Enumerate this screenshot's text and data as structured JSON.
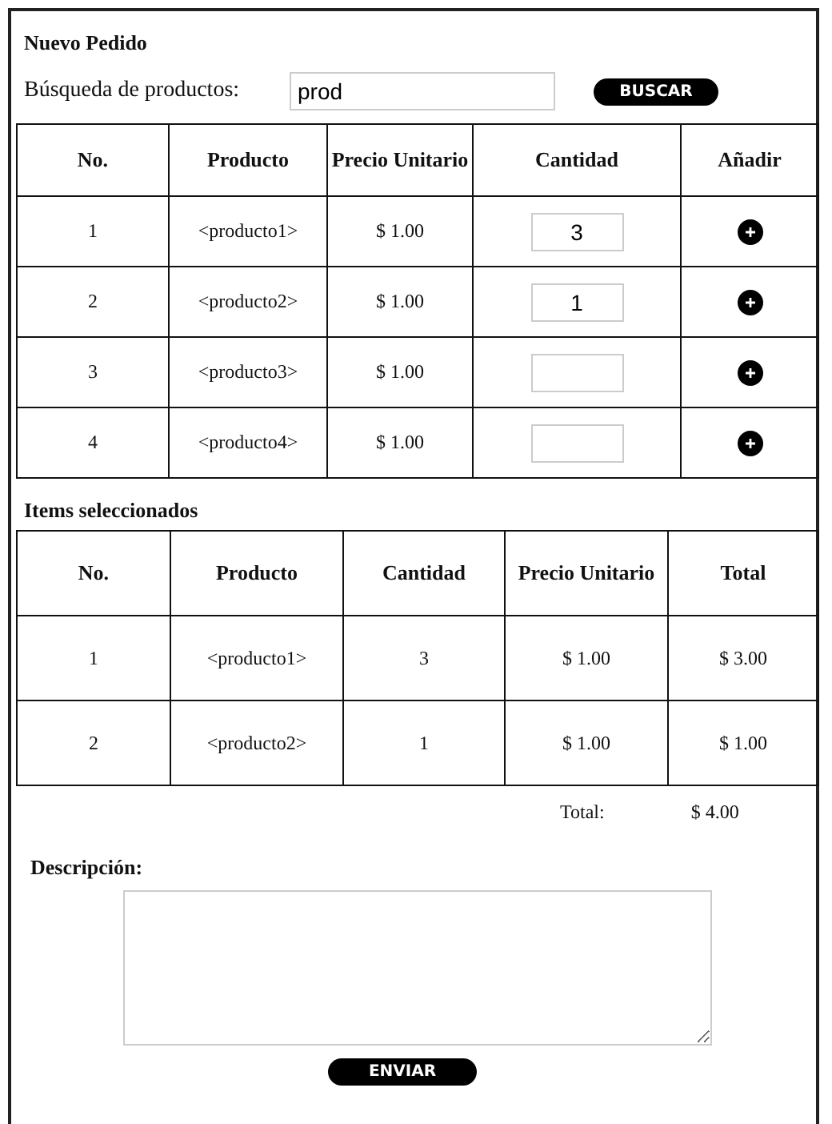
{
  "title": "Nuevo Pedido",
  "search": {
    "label": "Búsqueda de productos:",
    "value": "prod",
    "button": "BUSCAR"
  },
  "products": {
    "columns": [
      "No.",
      "Producto",
      "Precio Unitario",
      "Cantidad",
      "Añadir"
    ],
    "rows": [
      {
        "no": "1",
        "product": "<producto1>",
        "price": "$ 1.00",
        "quantity": "3"
      },
      {
        "no": "2",
        "product": "<producto2>",
        "price": "$ 1.00",
        "quantity": "1"
      },
      {
        "no": "3",
        "product": "<producto3>",
        "price": "$ 1.00",
        "quantity": ""
      },
      {
        "no": "4",
        "product": "<producto4>",
        "price": "$ 1.00",
        "quantity": ""
      }
    ]
  },
  "selected": {
    "title": "Items seleccionados",
    "columns": [
      "No.",
      "Producto",
      "Cantidad",
      "Precio Unitario",
      "Total"
    ],
    "rows": [
      [
        "1",
        "<producto1>",
        "3",
        "$ 1.00",
        "$ 3.00"
      ],
      [
        "2",
        "<producto2>",
        "1",
        "$ 1.00",
        "$ 1.00"
      ]
    ],
    "total_label": "Total:",
    "total_value": "$ 4.00"
  },
  "description": {
    "label": "Descripción:"
  },
  "submit": "ENVIAR"
}
